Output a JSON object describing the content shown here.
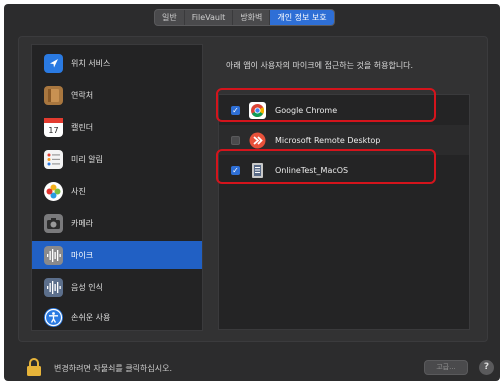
{
  "tabs": [
    {
      "label": "일반"
    },
    {
      "label": "FileVault"
    },
    {
      "label": "방화벽"
    },
    {
      "label": "개인 정보 보호"
    }
  ],
  "sidebar": {
    "items": [
      {
        "label": "위치 서비스",
        "icon": "location-arrow-icon"
      },
      {
        "label": "연락처",
        "icon": "contacts-book-icon"
      },
      {
        "label": "캘린더",
        "icon": "calendar-icon",
        "icon_text": "17"
      },
      {
        "label": "미리 알림",
        "icon": "reminders-icon"
      },
      {
        "label": "사진",
        "icon": "photos-icon"
      },
      {
        "label": "카메라",
        "icon": "camera-icon"
      },
      {
        "label": "마이크",
        "icon": "microphone-waveform-icon",
        "selected": true
      },
      {
        "label": "음성 인식",
        "icon": "speech-recognition-icon"
      },
      {
        "label": "손쉬운 사용",
        "icon": "accessibility-icon"
      }
    ]
  },
  "main": {
    "description": "아래 앱이 사용자의 마이크에 접근하는 것을 허용합니다.",
    "apps": [
      {
        "name": "Google Chrome",
        "checked": true,
        "icon": "chrome-icon",
        "highlighted": true
      },
      {
        "name": "Microsoft Remote Desktop",
        "checked": false,
        "icon": "remote-desktop-icon",
        "highlighted": false
      },
      {
        "name": "OnlineTest_MacOS",
        "checked": true,
        "icon": "app-document-icon",
        "highlighted": true
      }
    ]
  },
  "footer": {
    "lock_text": "변경하려면 자물쇠를 클릭하십시오.",
    "advanced_label": "고급...",
    "help_label": "?"
  },
  "colors": {
    "accent": "#2e6fd6",
    "highlight_red": "#d4141c",
    "window_bg": "#2c2c2d"
  }
}
